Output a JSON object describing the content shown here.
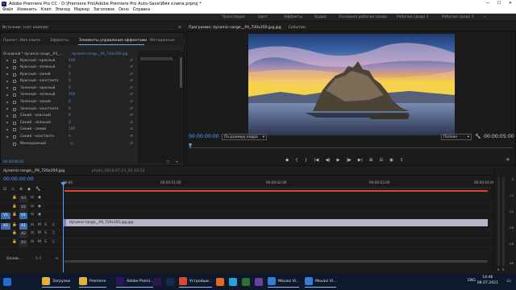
{
  "titlebar": {
    "title": "Adobe Premiere Pro CC - D:\\Premiere Pro\\Adobe Premiere Pro Auto-Save\\Имя клипа.prproj *",
    "minimize": "—",
    "maximize": "☐",
    "close": "✕"
  },
  "menu": [
    "Файл",
    "Изменить",
    "Клип",
    "Эпизод",
    "Маркер",
    "Заголовок",
    "Окно",
    "Справка"
  ],
  "workspaces": [
    "Трансляция",
    "Цвет",
    "Эффекты",
    "Аудио",
    "Основная рабочая среда",
    "Рабочая среда 2",
    "Рабочая среда 1"
  ],
  "source_panel": {
    "title": "Источник: (нет клипов)",
    "menu_icon": "≡"
  },
  "effect_tabs": [
    "Проект: Имя клипа",
    "Эффекты",
    "Элементы управления эффектами",
    "Метаданные"
  ],
  "effect_controls": {
    "master_label": "Основной * dynamic-range__P4_...",
    "clip_label": "dynamic-range__P4_720x350.jpg",
    "timecode": "00:00",
    "end_tc": "00:00",
    "rows": [
      {
        "label": "Красный - красный",
        "value": "100"
      },
      {
        "label": "Красный - зеленый",
        "value": "0"
      },
      {
        "label": "Красный - синий",
        "value": "0"
      },
      {
        "label": "Красный - константа",
        "value": "0"
      },
      {
        "label": "Зеленый - красный",
        "value": "0"
      },
      {
        "label": "Зеленый - зеленый",
        "value": "100"
      },
      {
        "label": "Зеленый - синий",
        "value": "0"
      },
      {
        "label": "Зеленый - константа",
        "value": "0"
      },
      {
        "label": "Синий - красный",
        "value": "0"
      },
      {
        "label": "Синий - зеленый",
        "value": "0"
      },
      {
        "label": "Синий - синий",
        "value": "100"
      },
      {
        "label": "Синий - константа",
        "value": "0"
      },
      {
        "label": "Монохромный",
        "value": ""
      }
    ],
    "footer_tc": "00:00:00:00"
  },
  "program": {
    "tabs": [
      "Программа: dynamic-range__P4_720x350.jpg.jpg",
      "События"
    ],
    "timecode": "00:00:00:00",
    "fit": "По размеру кадра",
    "quality": "Полное",
    "duration": "00:00:05:00",
    "transport": [
      "◆",
      "{",
      "}",
      "|◀",
      "◀|",
      "▶",
      "|▶",
      "▶|",
      "⊞",
      "⊟",
      "◉",
      "⇪"
    ],
    "add": "+"
  },
  "timeline": {
    "tabs": [
      "dynamic-range__P4_720x350.jpg",
      "photo_2018-07-23_02-43-23"
    ],
    "timecode": "00:00:00:00",
    "ruler": [
      "00:00",
      "00:00:01:00",
      "00:00:02:00",
      "00:00:03:00",
      "00:00:04:00"
    ],
    "tracks": [
      {
        "name": "",
        "box": "V3",
        "kind": "video"
      },
      {
        "name": "",
        "box": "V2",
        "kind": "video"
      },
      {
        "name": "V1",
        "box": "V1",
        "kind": "video"
      },
      {
        "name": "A1",
        "box": "A1",
        "kind": "audio"
      },
      {
        "name": "",
        "box": "A2",
        "kind": "audio"
      },
      {
        "name": "",
        "box": "A3",
        "kind": "audio"
      }
    ],
    "master": "Основ...",
    "master_value": "0,0",
    "clip": "dynamic-range__P4_720x350.jpg.jpg",
    "mute_solo": [
      "M",
      "S"
    ]
  },
  "meters": {
    "scale": [
      "0",
      "-12",
      "-24",
      "-36",
      "-48",
      "dB"
    ],
    "channels": [
      "S",
      "S"
    ]
  },
  "taskbar": {
    "apps": [
      {
        "label": "",
        "icon": "windows-icon",
        "color": "#1f6fd0"
      },
      {
        "label": "",
        "icon": "search-icon",
        "color": "#0e1a2b"
      },
      {
        "label": "",
        "icon": "task-view-icon",
        "color": "#0e1a2b"
      },
      {
        "label": "Загрузки",
        "icon": "folder-icon",
        "color": "#e3b23c"
      },
      {
        "label": "Premiere",
        "icon": "folder-icon",
        "color": "#e3b23c"
      },
      {
        "label": "Adobe Premi...",
        "icon": "premiere-icon",
        "color": "#2a155e"
      },
      {
        "label": "",
        "icon": "after-effects-icon",
        "color": "#2b1650"
      },
      {
        "label": "",
        "icon": "media-encoder-icon",
        "color": "#1b2a4a"
      },
      {
        "label": "Устройши...",
        "icon": "chrome-icon",
        "color": "#d64a3a"
      },
      {
        "label": "",
        "icon": "firefox-icon",
        "color": "#e66a1d"
      },
      {
        "label": "",
        "icon": "telegram-icon",
        "color": "#2aa0d8"
      },
      {
        "label": "",
        "icon": "app-icon",
        "color": "#2f6f2f"
      },
      {
        "label": "",
        "icon": "app-icon",
        "color": "#6b3fa0"
      },
      {
        "label": "Movavi Vi...",
        "icon": "movavi-icon",
        "color": "#3a7ad1"
      },
      {
        "label": "Movavi Vi...",
        "icon": "movavi-icon",
        "color": "#3a7ad1"
      }
    ],
    "lang": "ENG",
    "time": "14:46",
    "date": "08.07.2021"
  }
}
